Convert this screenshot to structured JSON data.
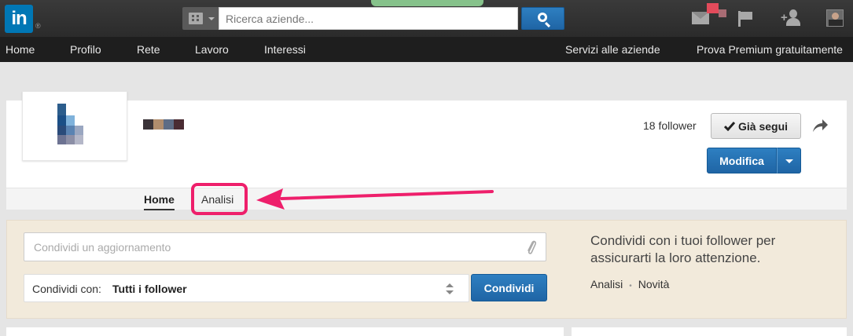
{
  "header": {
    "logo_text": "in",
    "search_placeholder": "Ricerca aziende...",
    "icons": [
      "company-building-icon",
      "search-icon",
      "messages-icon",
      "flag-icon",
      "add-connection-icon",
      "user-avatar"
    ]
  },
  "nav": {
    "items": [
      "Home",
      "Profilo",
      "Rete",
      "Lavoro",
      "Interessi"
    ],
    "right_items": [
      "Servizi alle aziende",
      "Prova Premium gratuitamente"
    ]
  },
  "company": {
    "follower_count": "18 follower",
    "follow_label": "Già segui",
    "edit_label": "Modifica",
    "tabs": [
      "Home",
      "Analisi"
    ]
  },
  "share": {
    "update_placeholder": "Condividi un aggiornamento",
    "share_with_label": "Condividi con:",
    "share_with_value": "Tutti i follower",
    "share_button": "Condividi",
    "tip": "Condividi con i tuoi follower per assicurarti la loro attenzione.",
    "links": [
      "Analisi",
      "Novità"
    ]
  },
  "colors": {
    "brand": "#0077b5",
    "primary_button": "#1f65a5",
    "highlight": "#ee1f6b",
    "share_panel_bg": "#f2eadb"
  }
}
